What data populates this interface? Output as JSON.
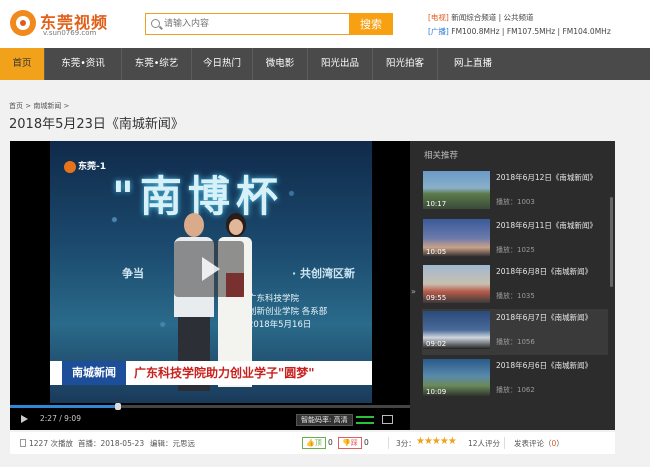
{
  "header": {
    "logo_title": "东莞视频",
    "logo_url": "v.sun0769.com",
    "search_placeholder": "请输入内容",
    "search_button": "搜索",
    "radio1_tag": "[电视]",
    "radio1_text": "新闻综合频道 | 公共频道",
    "radio2_tag": "[广播]",
    "radio2_text": "FM100.8MHz | FM107.5MHz | FM104.0MHz"
  },
  "nav": {
    "items": [
      {
        "label": "首页",
        "active": true
      },
      {
        "label": "东莞•资讯"
      },
      {
        "label": "东莞•综艺"
      },
      {
        "label": "今日热门"
      },
      {
        "label": "微电影"
      },
      {
        "label": "阳光出品"
      },
      {
        "label": "阳光拍客"
      },
      {
        "label": "网上直播"
      }
    ]
  },
  "breadcrumb": "首页 > 南城新闻 >",
  "page_title": "2018年5月23日《南城新闻》",
  "player": {
    "channel_logo": "东莞-1",
    "banner_text": "\"南博杯",
    "slogan": "争当",
    "slogan_right": "· 共创湾区新",
    "school_line1": "广东科技学院",
    "school_line2": "创新创业学院  各系部",
    "school_line3": "2018年5月16日",
    "lower_brand": "南城新闻",
    "lower_headline": "广东科技学院助力创业学子\"圆梦\"",
    "time": "2:27 / 9:09",
    "progress": 0.27,
    "quality": "智能码率: 高清"
  },
  "related": {
    "title": "相关推荐",
    "items": [
      {
        "title": "2018年6月12日《南城新闻》",
        "plays": "播放：1003",
        "duration": "10:17"
      },
      {
        "title": "2018年6月11日《南城新闻》",
        "plays": "播放：1025",
        "duration": "10:05"
      },
      {
        "title": "2018年6月8日《南城新闻》",
        "plays": "播放：1035",
        "duration": "09:55"
      },
      {
        "title": "2018年6月7日《南城新闻》",
        "plays": "播放：1056",
        "duration": "09:02"
      },
      {
        "title": "2018年6月6日《南城新闻》",
        "plays": "播放：1062",
        "duration": "10:09"
      }
    ]
  },
  "info": {
    "plays": "1227 次播放",
    "date": "首播：2018-05-23",
    "editor": "编辑：元思远",
    "up_label": "顶",
    "up_count": "0",
    "down_label": "踩",
    "down_count": "0",
    "score_label": "3分：",
    "stars": "★★★★★",
    "rating_count": "12人评分",
    "comment_label": "发表评论（",
    "comment_count": "0",
    "comment_end": "）"
  }
}
